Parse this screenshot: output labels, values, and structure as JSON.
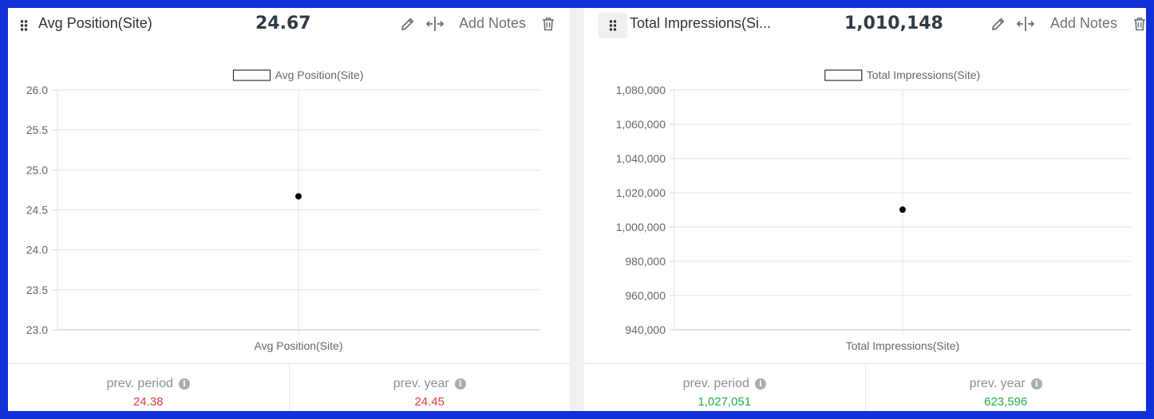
{
  "colors": {
    "negative": "#e0393e",
    "positive": "#21b04b",
    "frame": "#1230d8"
  },
  "icons": {
    "drag": "drag-dots-icon",
    "edit": "pencil-icon",
    "move": "move-arrows-icon",
    "delete": "trash-icon",
    "info": "info-icon"
  },
  "widgets": [
    {
      "title": "Avg Position(Site)",
      "value": "24.67",
      "add_notes": "Add Notes",
      "footer": [
        {
          "label": "prev. period",
          "value": "24.38",
          "trend": "negative"
        },
        {
          "label": "prev. year",
          "value": "24.45",
          "trend": "negative"
        }
      ]
    },
    {
      "title": "Total Impressions(Si...",
      "value": "1,010,148",
      "add_notes": "Add Notes",
      "footer": [
        {
          "label": "prev. period",
          "value": "1,027,051",
          "trend": "positive"
        },
        {
          "label": "prev. year",
          "value": "623,596",
          "trend": "positive"
        }
      ]
    }
  ],
  "chart_data": [
    {
      "type": "scatter",
      "legend": "Avg Position(Site)",
      "legend_position": "top",
      "categories": [
        "Avg Position(Site)"
      ],
      "series": [
        {
          "name": "Avg Position(Site)",
          "values": [
            24.67
          ]
        }
      ],
      "ylim": [
        23.0,
        26.0
      ],
      "y_ticks": [
        "26.0",
        "25.5",
        "25.0",
        "24.5",
        "24.0",
        "23.5",
        "23.0"
      ],
      "grid": true
    },
    {
      "type": "scatter",
      "legend": "Total Impressions(Site)",
      "legend_position": "top",
      "categories": [
        "Total Impressions(Site)"
      ],
      "series": [
        {
          "name": "Total Impressions(Site)",
          "values": [
            1010148
          ]
        }
      ],
      "ylim": [
        940000,
        1080000
      ],
      "y_ticks": [
        "1,080,000",
        "1,060,000",
        "1,040,000",
        "1,020,000",
        "1,000,000",
        "980,000",
        "960,000",
        "940,000"
      ],
      "grid": true
    }
  ]
}
